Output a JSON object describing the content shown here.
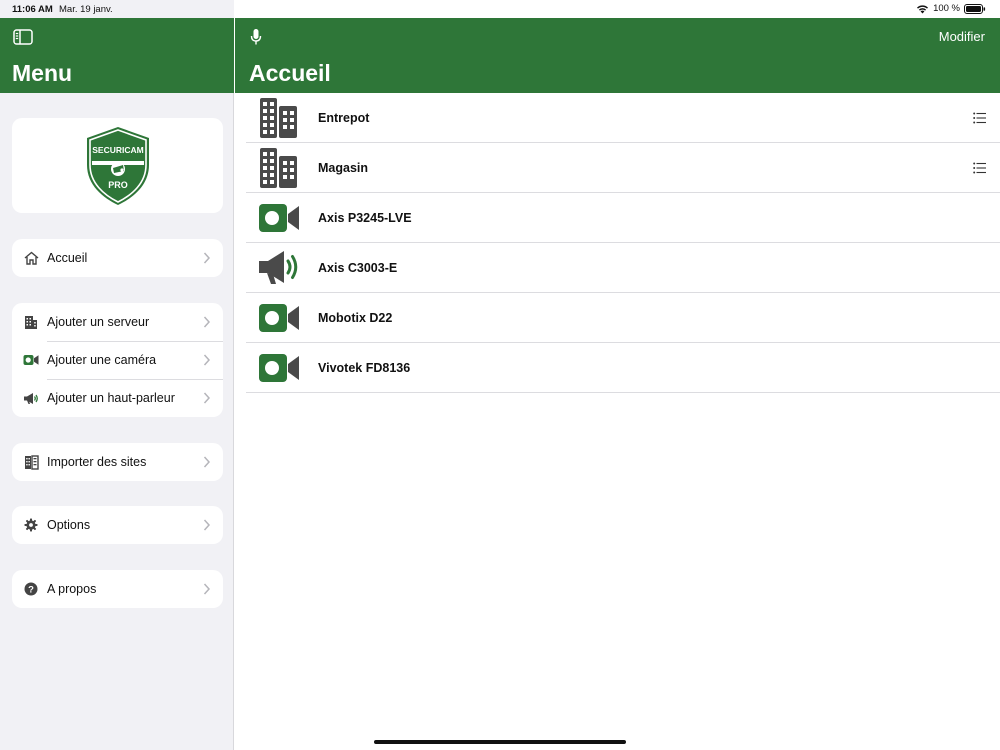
{
  "status_bar": {
    "time": "11:06 AM",
    "date": "Mar. 19 janv.",
    "battery": "100 %"
  },
  "sidebar": {
    "title": "Menu",
    "logo": {
      "top_text": "SECURICAM",
      "bottom_text": "PRO"
    },
    "groups": [
      {
        "items": [
          {
            "label": "Accueil",
            "icon": "home-icon"
          }
        ]
      },
      {
        "items": [
          {
            "label": "Ajouter un serveur",
            "icon": "building-icon"
          },
          {
            "label": "Ajouter une caméra",
            "icon": "video-camera-icon"
          },
          {
            "label": "Ajouter un haut-parleur",
            "icon": "megaphone-icon"
          }
        ]
      },
      {
        "items": [
          {
            "label": "Importer des sites",
            "icon": "import-sites-icon"
          }
        ]
      },
      {
        "items": [
          {
            "label": "Options",
            "icon": "gear-icon"
          }
        ]
      },
      {
        "items": [
          {
            "label": "A propos",
            "icon": "help-icon"
          }
        ]
      }
    ]
  },
  "main": {
    "title": "Accueil",
    "edit_label": "Modifier",
    "items": [
      {
        "name": "Entrepot",
        "icon": "building-icon",
        "has_menu": true
      },
      {
        "name": "Magasin",
        "icon": "building-icon",
        "has_menu": true
      },
      {
        "name": "Axis P3245-LVE",
        "icon": "video-camera-icon",
        "has_menu": false
      },
      {
        "name": "Axis C3003-E",
        "icon": "megaphone-icon",
        "has_menu": false
      },
      {
        "name": "Mobotix D22",
        "icon": "video-camera-icon",
        "has_menu": false
      },
      {
        "name": "Vivotek FD8136",
        "icon": "video-camera-icon",
        "has_menu": false
      }
    ]
  },
  "colors": {
    "brand_green": "#2e7638",
    "icon_gray": "#4a4a4a",
    "sidebar_bg": "#f1f1f5"
  }
}
